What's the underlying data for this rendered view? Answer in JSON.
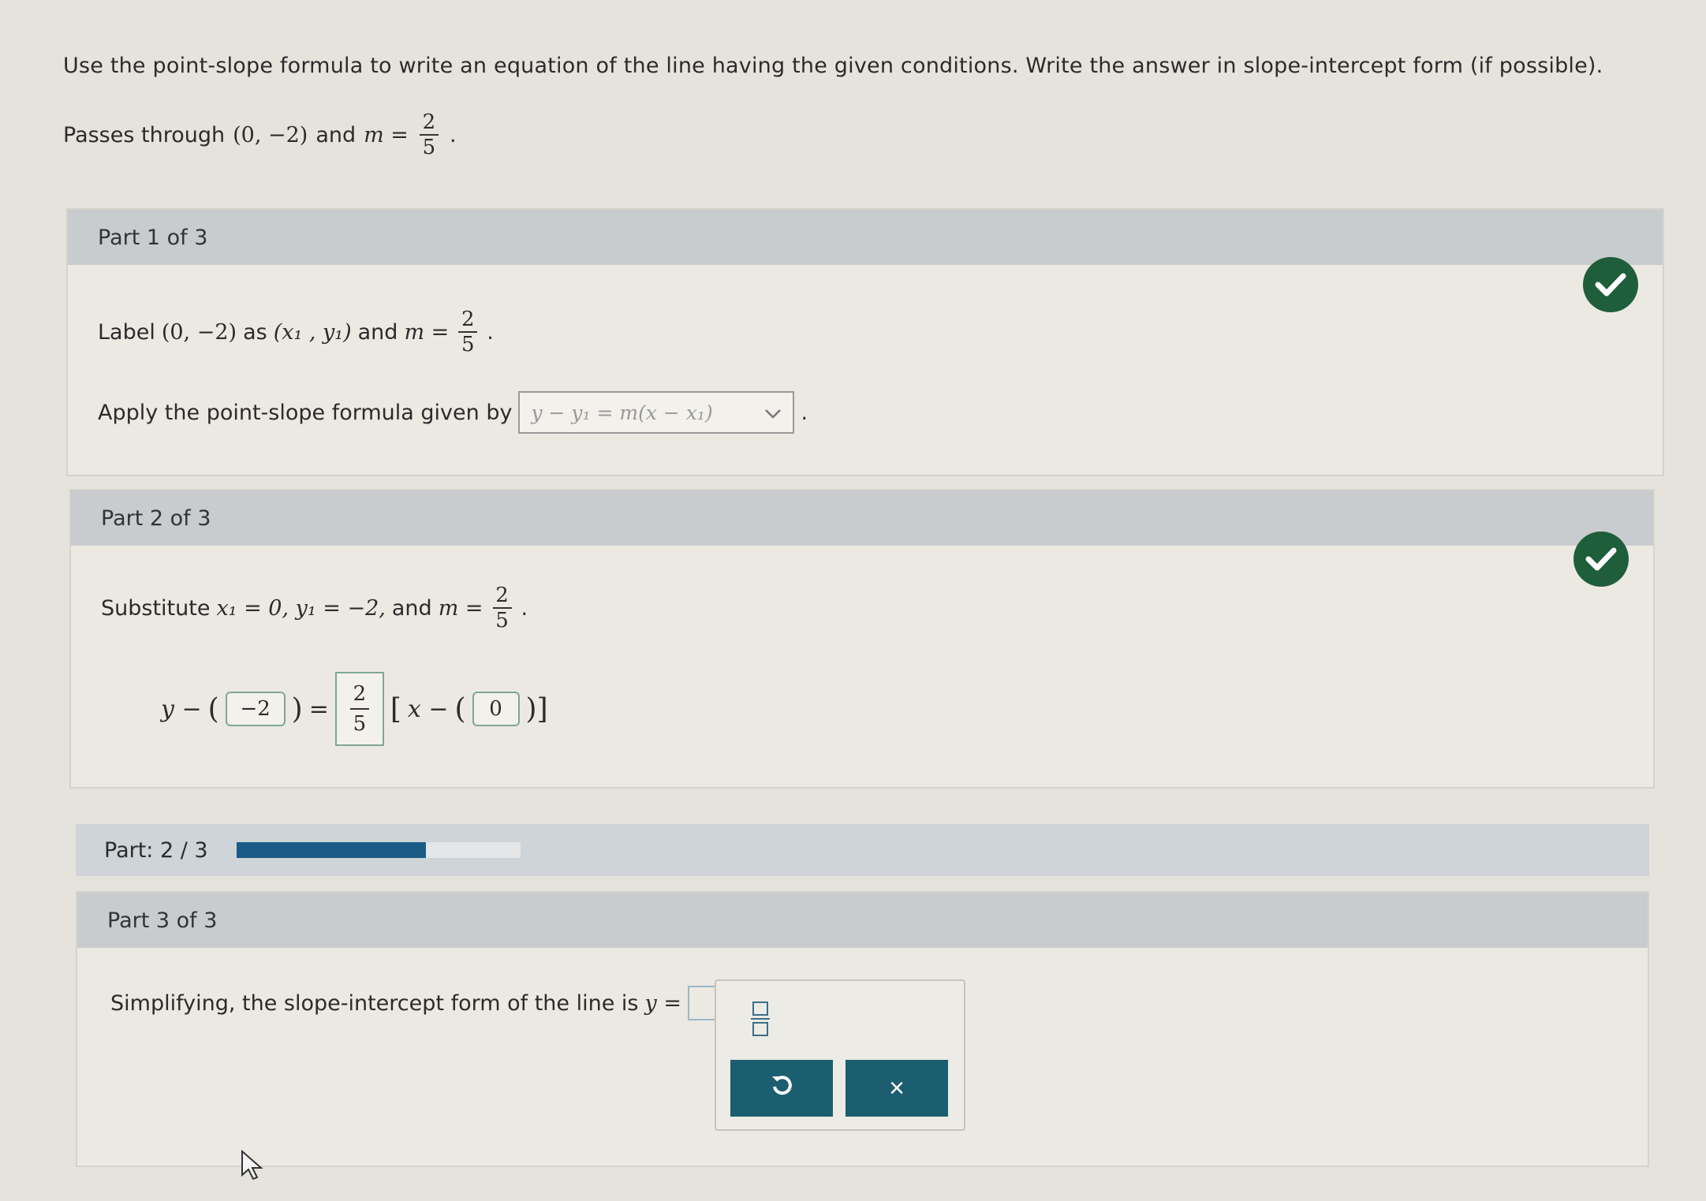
{
  "prompt": "Use the point-slope formula to write an equation of the line having the given conditions. Write the answer in slope-intercept form (if possible).",
  "given": {
    "prefix": "Passes through",
    "point": "(0, −2)",
    "and": "and",
    "m_label": "m =",
    "m_num": "2",
    "m_den": "5"
  },
  "part1": {
    "header": "Part 1 of 3",
    "label_text": "Label",
    "point": "(0, −2)",
    "as_text": "as",
    "xy": "(x₁ , y₁)",
    "and_text": "and",
    "m_label": "m =",
    "m_num": "2",
    "m_den": "5",
    "apply_text": "Apply the point-slope formula given by",
    "dropdown_value": "y − y₁ = m(x − x₁)"
  },
  "part2": {
    "header": "Part 2 of 3",
    "substitute_text": "Substitute",
    "x1_expr": "x₁ = 0, y₁ = −2,",
    "and_text": "and",
    "m_label": "m =",
    "m_num": "2",
    "m_den": "5",
    "eq_y": "y −",
    "y1_value": "−2",
    "eq_equals": "=",
    "slope_num": "2",
    "slope_den": "5",
    "eq_x": "x −",
    "x1_value": "0"
  },
  "progress": {
    "label": "Part: 2 / 3",
    "fraction": 0.667
  },
  "part3": {
    "header": "Part 3 of 3",
    "text": "Simplifying, the slope-intercept form of the line is",
    "y_eq": "y ="
  },
  "palette": {
    "undo_icon": "undo-icon",
    "clear_icon": "close-icon",
    "clear_glyph": "×",
    "undo_glyph": "↻"
  },
  "colors": {
    "check": "#1f5e3a",
    "button": "#1b5e6f",
    "progress_fill": "#1a5c86"
  }
}
